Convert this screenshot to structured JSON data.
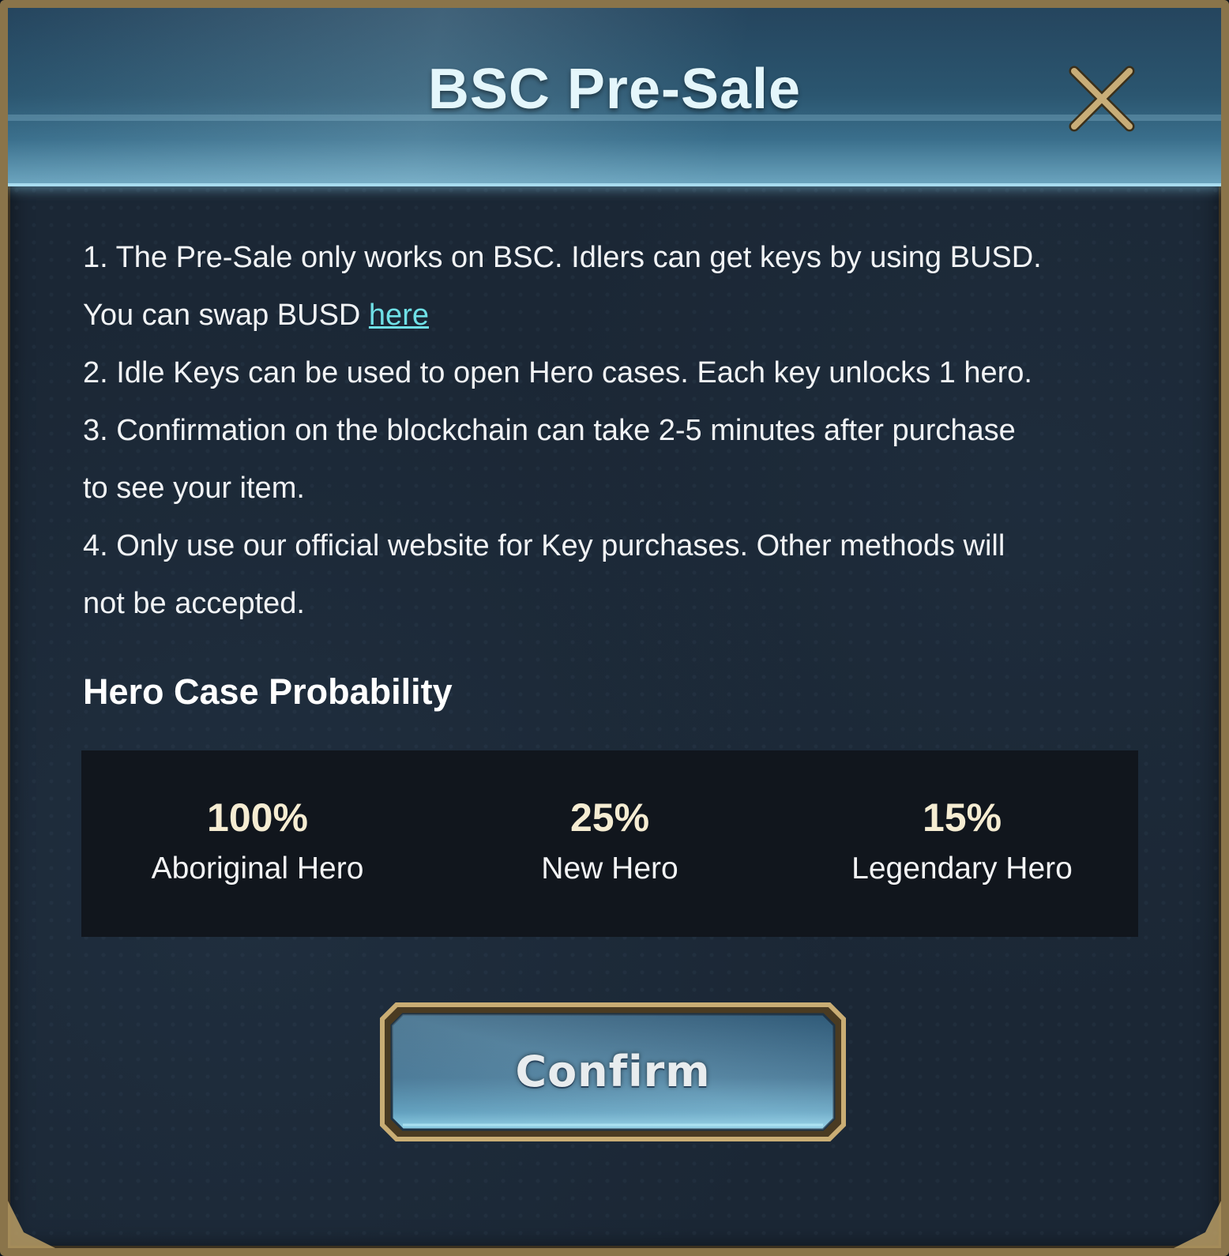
{
  "dialog": {
    "title": "BSC Pre-Sale"
  },
  "rules": {
    "line1": "1. The Pre-Sale only works on BSC. Idlers can get keys by using BUSD.",
    "line1b_prefix": "You can swap BUSD ",
    "line1b_link": "here",
    "line2": "2. Idle Keys can be used to open Hero cases. Each key unlocks 1 hero.",
    "line3": "3. Confirmation on the blockchain can take 2-5 minutes after purchase",
    "line3b": "to see your item.",
    "line4": "4. Only use our official website for Key purchases. Other methods will",
    "line4b": "not be accepted."
  },
  "probability": {
    "heading": "Hero Case Probability",
    "items": [
      {
        "percent": "100%",
        "label": "Aboriginal Hero"
      },
      {
        "percent": "25%",
        "label": "New Hero"
      },
      {
        "percent": "15%",
        "label": "Legendary Hero"
      }
    ]
  },
  "actions": {
    "confirm_label": "Confirm"
  },
  "icons": {
    "close": "close-icon"
  },
  "colors": {
    "accent_link": "#6fe0e6",
    "frame_gold": "#8a744a",
    "header_blue": "#2b5670",
    "percent_text": "#f5ecd2"
  }
}
